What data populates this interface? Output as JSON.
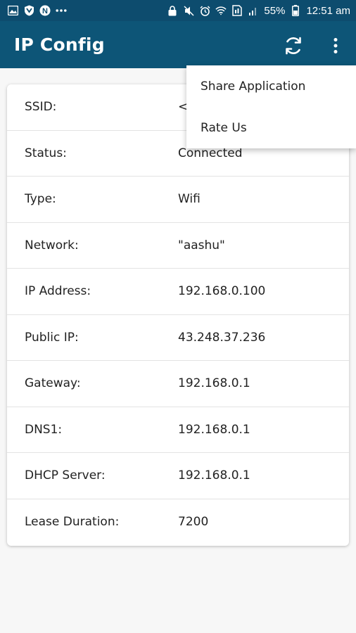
{
  "status_bar": {
    "left_icons": [
      "gallery-icon",
      "shield-icon",
      "n-badge-icon",
      "more-dots-icon"
    ],
    "right_icons": [
      "lock-icon",
      "mute-icon",
      "alarm-icon",
      "wifi-icon",
      "sim-icon",
      "signal-icon",
      "battery-icon"
    ],
    "battery": "55%",
    "time": "12:51 am"
  },
  "app_bar": {
    "title": "IP Config",
    "actions": [
      "refresh-icon",
      "overflow-menu-icon"
    ],
    "background": "#0d5577"
  },
  "menu": {
    "items": [
      "Share Application",
      "Rate Us"
    ]
  },
  "info": {
    "rows": [
      {
        "label": "SSID:",
        "value": "<"
      },
      {
        "label": "Status:",
        "value": "Connected"
      },
      {
        "label": "Type:",
        "value": "Wifi"
      },
      {
        "label": "Network:",
        "value": "\"aashu\""
      },
      {
        "label": "IP Address:",
        "value": "192.168.0.100"
      },
      {
        "label": "Public IP:",
        "value": "43.248.37.236"
      },
      {
        "label": "Gateway:",
        "value": "192.168.0.1"
      },
      {
        "label": "DNS1:",
        "value": "192.168.0.1"
      },
      {
        "label": "DHCP Server:",
        "value": "192.168.0.1"
      },
      {
        "label": "Lease Duration:",
        "value": "7200"
      }
    ]
  }
}
